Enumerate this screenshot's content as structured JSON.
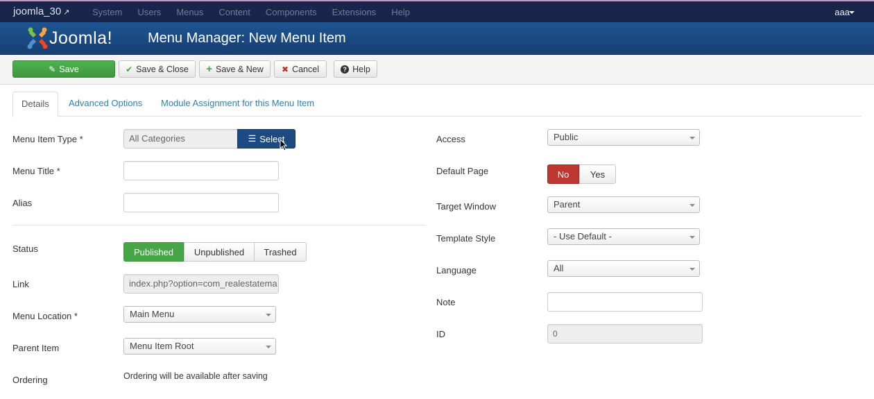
{
  "topnav": {
    "site_name": "joomla_30",
    "external_icon": "external-link-icon",
    "menu": [
      "System",
      "Users",
      "Menus",
      "Content",
      "Components",
      "Extensions",
      "Help"
    ],
    "user": "aaa"
  },
  "header": {
    "logo_text": "Joomla!",
    "title": "Menu Manager: New Menu Item"
  },
  "toolbar": {
    "save": "Save",
    "save_close": "Save & Close",
    "save_new": "Save & New",
    "cancel": "Cancel",
    "help": "Help"
  },
  "tabs": [
    "Details",
    "Advanced Options",
    "Module Assignment for this Menu Item"
  ],
  "left": {
    "menu_item_type": {
      "label": "Menu Item Type *",
      "value": "All Categories",
      "button": "Select"
    },
    "menu_title": {
      "label": "Menu Title *",
      "value": ""
    },
    "alias": {
      "label": "Alias",
      "value": ""
    },
    "status": {
      "label": "Status",
      "options": [
        "Published",
        "Unpublished",
        "Trashed"
      ],
      "selected": "Published"
    },
    "link": {
      "label": "Link",
      "value": "index.php?option=com_realestatema"
    },
    "menu_location": {
      "label": "Menu Location *",
      "value": "Main Menu"
    },
    "parent_item": {
      "label": "Parent Item",
      "value": "Menu Item Root"
    },
    "ordering": {
      "label": "Ordering",
      "value": "Ordering will be available after saving"
    }
  },
  "right": {
    "access": {
      "label": "Access",
      "value": "Public"
    },
    "default_page": {
      "label": "Default Page",
      "options": [
        "No",
        "Yes"
      ],
      "selected": "No"
    },
    "target_window": {
      "label": "Target Window",
      "value": "Parent"
    },
    "template_style": {
      "label": "Template Style",
      "value": "- Use Default -"
    },
    "language": {
      "label": "Language",
      "value": "All"
    },
    "note": {
      "label": "Note",
      "value": ""
    },
    "id": {
      "label": "ID",
      "value": "0"
    }
  },
  "colors": {
    "topnav_bg": "#17264a",
    "header_bg": "#1d5591",
    "save_green": "#46a546",
    "select_blue": "#1d4a80",
    "no_red": "#bd362f",
    "link_blue": "#2a83b2"
  }
}
